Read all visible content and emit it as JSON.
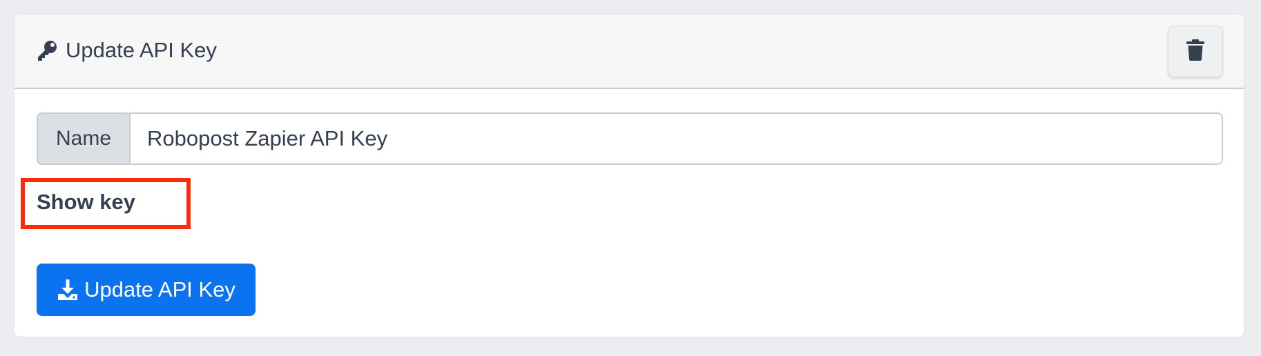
{
  "header": {
    "title": "Update API Key",
    "title_icon": "key-icon",
    "delete_icon": "trash-icon"
  },
  "form": {
    "name_label": "Name",
    "name_value": "Robopost Zapier API Key",
    "show_key_label": "Show key"
  },
  "actions": {
    "update_label": "Update API Key",
    "update_icon": "download-icon"
  },
  "colors": {
    "accent": "#0b73f0",
    "highlight": "#ff2a0a",
    "text": "#344050"
  }
}
